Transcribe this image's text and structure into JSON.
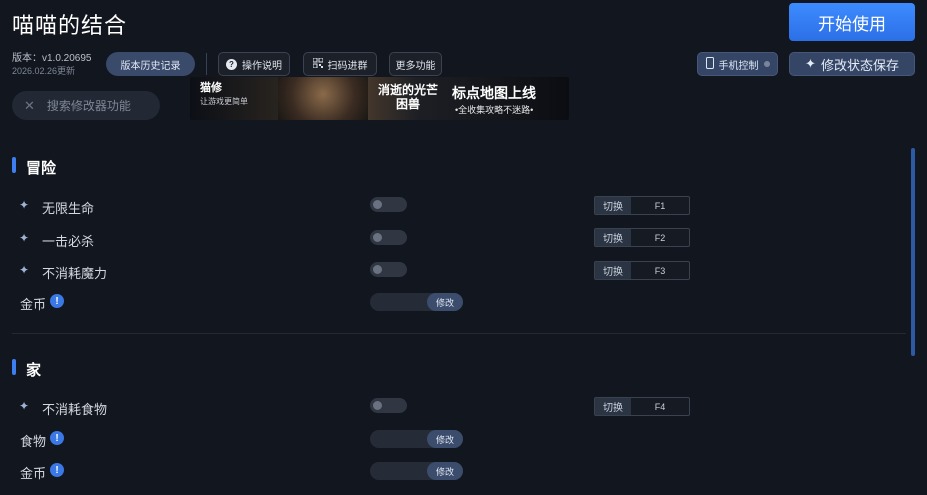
{
  "header": {
    "title": "喵喵的结合",
    "start_label": "开始使用",
    "version_label": "版本：v1.0.20695",
    "update_date": "2026.02.26更新",
    "history_label": "版本历史记录",
    "help_label": "操作说明",
    "qr_label": "扫码进群",
    "more_label": "更多功能",
    "phone_label": "手机控制",
    "save_label": "修改状态保存"
  },
  "search": {
    "placeholder": "搜索修改器功能"
  },
  "banner": {
    "brand": "猫修",
    "brand_sub": "让游戏更简单",
    "game": "消逝的光芒 困兽",
    "headline": "标点地图上线",
    "tagline": "•全收集攻略不迷路•"
  },
  "sections": [
    {
      "title": "冒险",
      "rows": [
        {
          "label": "无限生命",
          "switch": "切换",
          "key": "F1"
        },
        {
          "label": "一击必杀",
          "switch": "切换",
          "key": "F2"
        },
        {
          "label": "不消耗魔力",
          "switch": "切换",
          "key": "F3"
        },
        {
          "label": "金币",
          "info": "!",
          "edit": "修改"
        }
      ]
    },
    {
      "title": "家",
      "rows": [
        {
          "label": "不消耗食物",
          "switch": "切换",
          "key": "F4"
        },
        {
          "label": "食物",
          "info": "!",
          "edit": "修改"
        },
        {
          "label": "金币",
          "info": "!",
          "edit": "修改"
        }
      ]
    }
  ],
  "colors": {
    "accent": "#3d7ef0",
    "background": "#12161e"
  }
}
